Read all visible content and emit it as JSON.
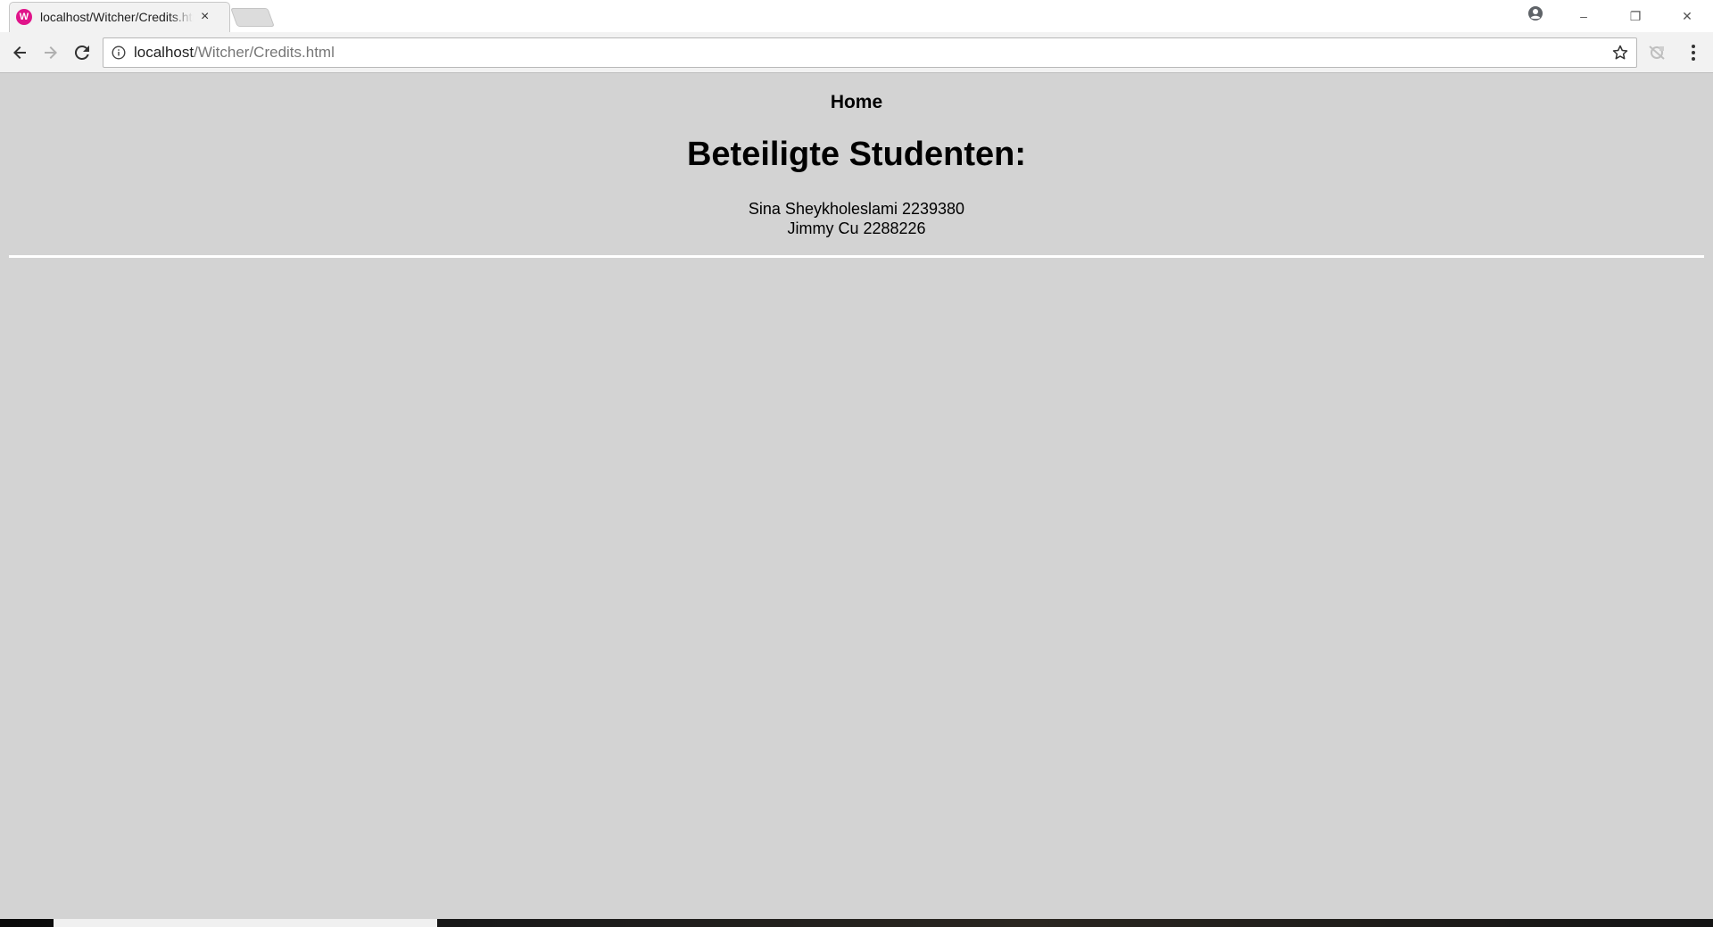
{
  "browser": {
    "tab_title": "localhost/Witcher/Credits.html",
    "tab_close_glyph": "×",
    "favicon_glyph": "W",
    "url_host": "localhost",
    "url_rest": "/Witcher/Credits.html",
    "accent_favicon": "#e0148a",
    "window_controls": {
      "minimize": "–",
      "restore": "❐",
      "close": "✕"
    },
    "icons": [
      "back-icon",
      "forward-icon",
      "reload-icon",
      "info-icon",
      "star-icon",
      "extension-icon",
      "menu-icon",
      "profile-icon"
    ]
  },
  "page": {
    "background": "#d3d3d3",
    "home_link": "Home",
    "heading": "Beteiligte Studenten:",
    "students": [
      "Sina Sheykholeslami 2239380",
      "Jimmy Cu 2288226"
    ]
  }
}
